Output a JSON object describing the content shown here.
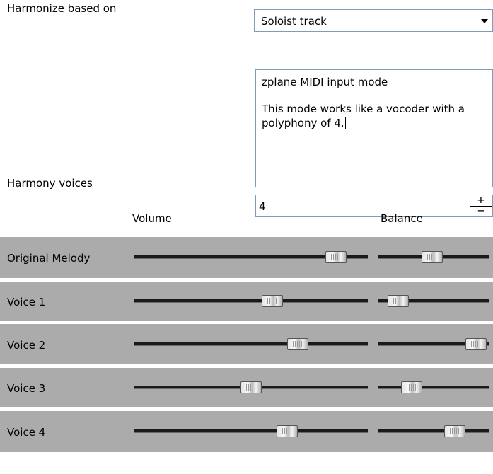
{
  "harmonize": {
    "label": "Harmonize based on",
    "selected": "Soloist track"
  },
  "info": {
    "line1": "zplane MIDI input mode",
    "line2": "This mode works like a vocoder with a polyphony of 4."
  },
  "voices_field": {
    "label": "Harmony voices",
    "value": "4",
    "plus": "+",
    "minus": "−"
  },
  "headers": {
    "volume": "Volume",
    "balance": "Balance"
  },
  "rows": [
    {
      "name": "Original Melody",
      "volume": 0.9,
      "balance": 0.48
    },
    {
      "name": "Voice 1",
      "volume": 0.6,
      "balance": 0.1
    },
    {
      "name": "Voice 2",
      "volume": 0.72,
      "balance": 0.97
    },
    {
      "name": "Voice 3",
      "volume": 0.5,
      "balance": 0.25
    },
    {
      "name": "Voice 4",
      "volume": 0.67,
      "balance": 0.73
    }
  ]
}
